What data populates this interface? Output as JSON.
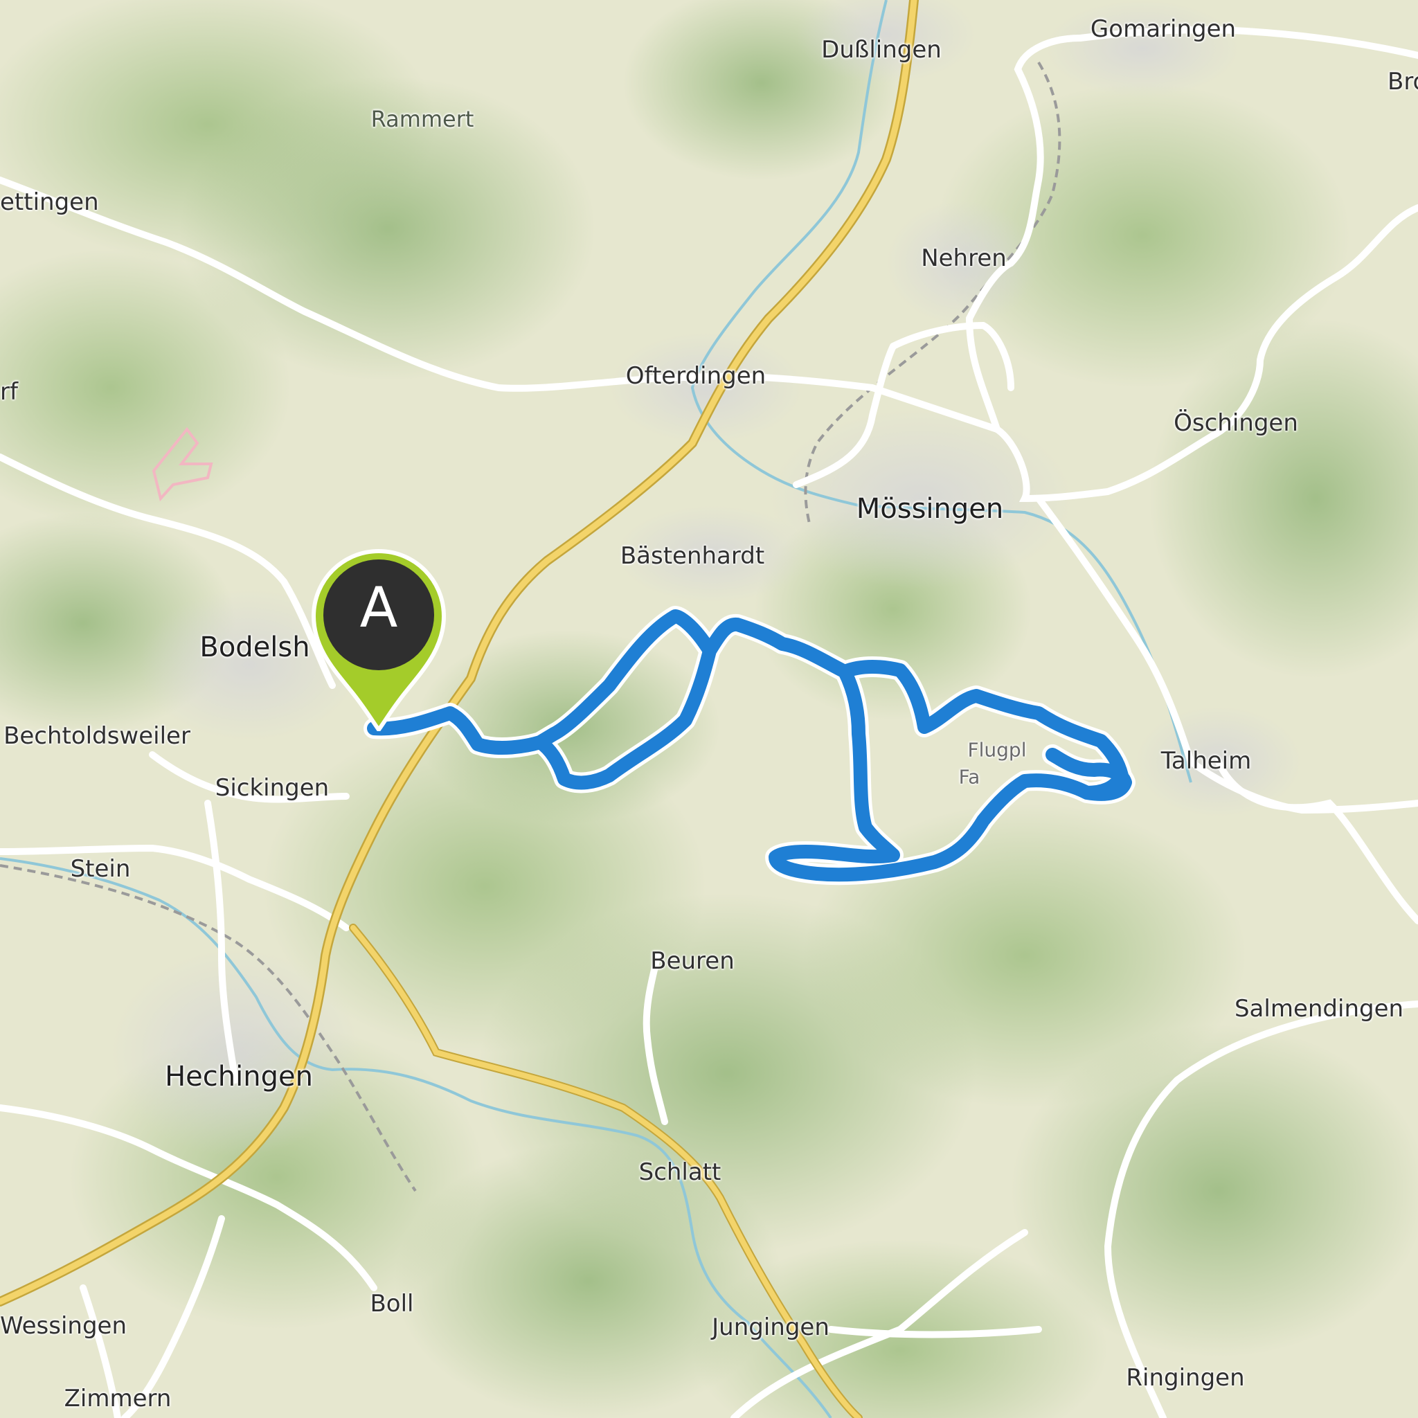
{
  "map": {
    "labels": {
      "rammert": "Rammert",
      "dusslingen": "Dußlingen",
      "gomaringen": "Gomaringen",
      "bro": "Bro",
      "ettingen": "ettingen",
      "nehren": "Nehren",
      "ofterdingen": "Ofterdingen",
      "rf": "rf",
      "oeschingen": "Öschingen",
      "moessingen": "Mössingen",
      "baestenhardt": "Bästenhardt",
      "bodelsh": "Bodelsh",
      "bechtoldsweiler": "Bechtoldsweiler",
      "sickingen": "Sickingen",
      "flugpl": "Flugpl",
      "fa": "Fa",
      "talheim": "Talheim",
      "stein": "Stein",
      "beuren": "Beuren",
      "salmendingen": "Salmendingen",
      "hechingen": "Hechingen",
      "schlatt": "Schlatt",
      "boll": "Boll",
      "wessingen": "Wessingen",
      "jungingen": "Jungingen",
      "ringingen": "Ringingen",
      "zimmern": "Zimmern"
    },
    "route_color": "#1f7fd4",
    "marker": {
      "letter": "A",
      "color": "#a4cc2a",
      "inner_color": "#2f2f2f"
    },
    "highway_color": "#f3d46a",
    "river_color": "#8fc7d8"
  }
}
